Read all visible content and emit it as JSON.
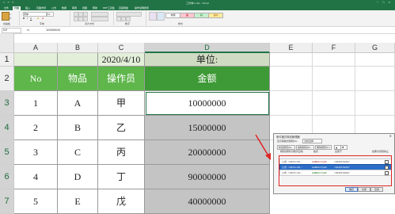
{
  "window": {
    "title": "工作簿1.xlsx - Excel",
    "quick_access": "⎌ ↶ ↷",
    "controls": "─ ☐ ✕"
  },
  "menu_tabs": [
    "文件",
    "开始",
    "插入",
    "页面布局",
    "公式",
    "数据",
    "审阅",
    "视图",
    "帮助",
    "PDF工具集",
    "百度网盘",
    "操作说明搜索"
  ],
  "ribbon": {
    "font_name": "宋体",
    "font_size": "11",
    "style_normal": "常规",
    "style_bad": "差",
    "style_good": "好",
    "style_neutral": "适中",
    "group_labels": [
      "剪贴板",
      "字体",
      "对齐方式",
      "数字",
      "样式"
    ]
  },
  "formula_bar": {
    "name_box": "D3",
    "fx": "fx",
    "value": "10000000"
  },
  "columns": [
    "A",
    "B",
    "C",
    "D",
    "E",
    "F",
    "G"
  ],
  "rows": [
    "1",
    "2",
    "3",
    "4",
    "5",
    "6",
    "7"
  ],
  "table": {
    "row1": [
      "",
      "",
      "2020/4/10",
      "单位:"
    ],
    "header": [
      "No",
      "物品",
      "操作员",
      "金额"
    ],
    "data": [
      [
        "1",
        "A",
        "甲",
        "10000000"
      ],
      [
        "2",
        "B",
        "乙",
        "15000000"
      ],
      [
        "3",
        "C",
        "丙",
        "20000000"
      ],
      [
        "4",
        "D",
        "丁",
        "90000000"
      ],
      [
        "5",
        "E",
        "戊",
        "40000000"
      ]
    ]
  },
  "dialog": {
    "title": "条件格式规则管理器",
    "show_rules_label": "显示其格式规则(S):",
    "show_rules_value": "当前选择",
    "buttons": [
      "新建规则(N)...",
      "编辑规则(E)...",
      "删除规则(D)"
    ],
    "columns": [
      "规则(按所示顺序应用)",
      "格式",
      "应用于",
      "如果为真则停止"
    ],
    "rules": [
      {
        "rule": "公式: =$D3>50...",
        "format": "AaBbCcYyZz",
        "applies_to": "=$D$3:$D$7"
      },
      {
        "rule": "公式: =$D3>30...",
        "format": "AaBbCcYyZz",
        "applies_to": "=$D$3:$D$7"
      },
      {
        "rule": "公式: =$D3>10...",
        "format": "AaBbCcYyZz",
        "applies_to": "=$D$3:$D$7"
      }
    ],
    "ok": "确定",
    "cancel": "关闭",
    "apply": "应用"
  },
  "colors": {
    "excel_green": "#217346",
    "header_green": "#5fb64b",
    "light_green": "#e3efd9",
    "selection_grey": "#c4c4c4",
    "annotation_red": "#e02424"
  }
}
